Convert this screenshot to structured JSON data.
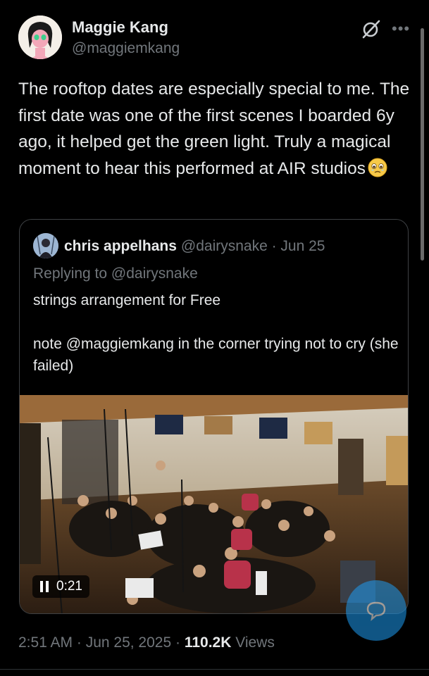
{
  "author": {
    "name": "Maggie Kang",
    "handle": "@maggiemkang"
  },
  "tweet": {
    "text": "The rooftop dates are especially special to me. The first date was one of the first scenes I boarded 6y ago, it helped get the green light. Truly a magical moment to hear this performed at AIR studios",
    "emoji": "face-holding-back-tears-emoji"
  },
  "quote": {
    "name": "chris appelhans",
    "meta": "@dairysnake · Jun 25",
    "replying": "Replying to @dairysnake",
    "text": "strings arrangement for Free\n\nnote @maggiemkang in the corner trying not to cry (she failed)",
    "video_time": "0:21"
  },
  "footer": {
    "time_date": "2:51 AM · Jun 25, 2025 · ",
    "views_count": "110.2K",
    "views_label": " Views"
  },
  "icons": {
    "grok": "grok-icon",
    "more": "more-icon",
    "reply_fab": "chat-bubble-icon",
    "pause": "pause-icon"
  },
  "colors": {
    "background": "#000000",
    "text": "#e7e9ea",
    "muted": "#71767b",
    "accent": "#1d9bf0"
  }
}
